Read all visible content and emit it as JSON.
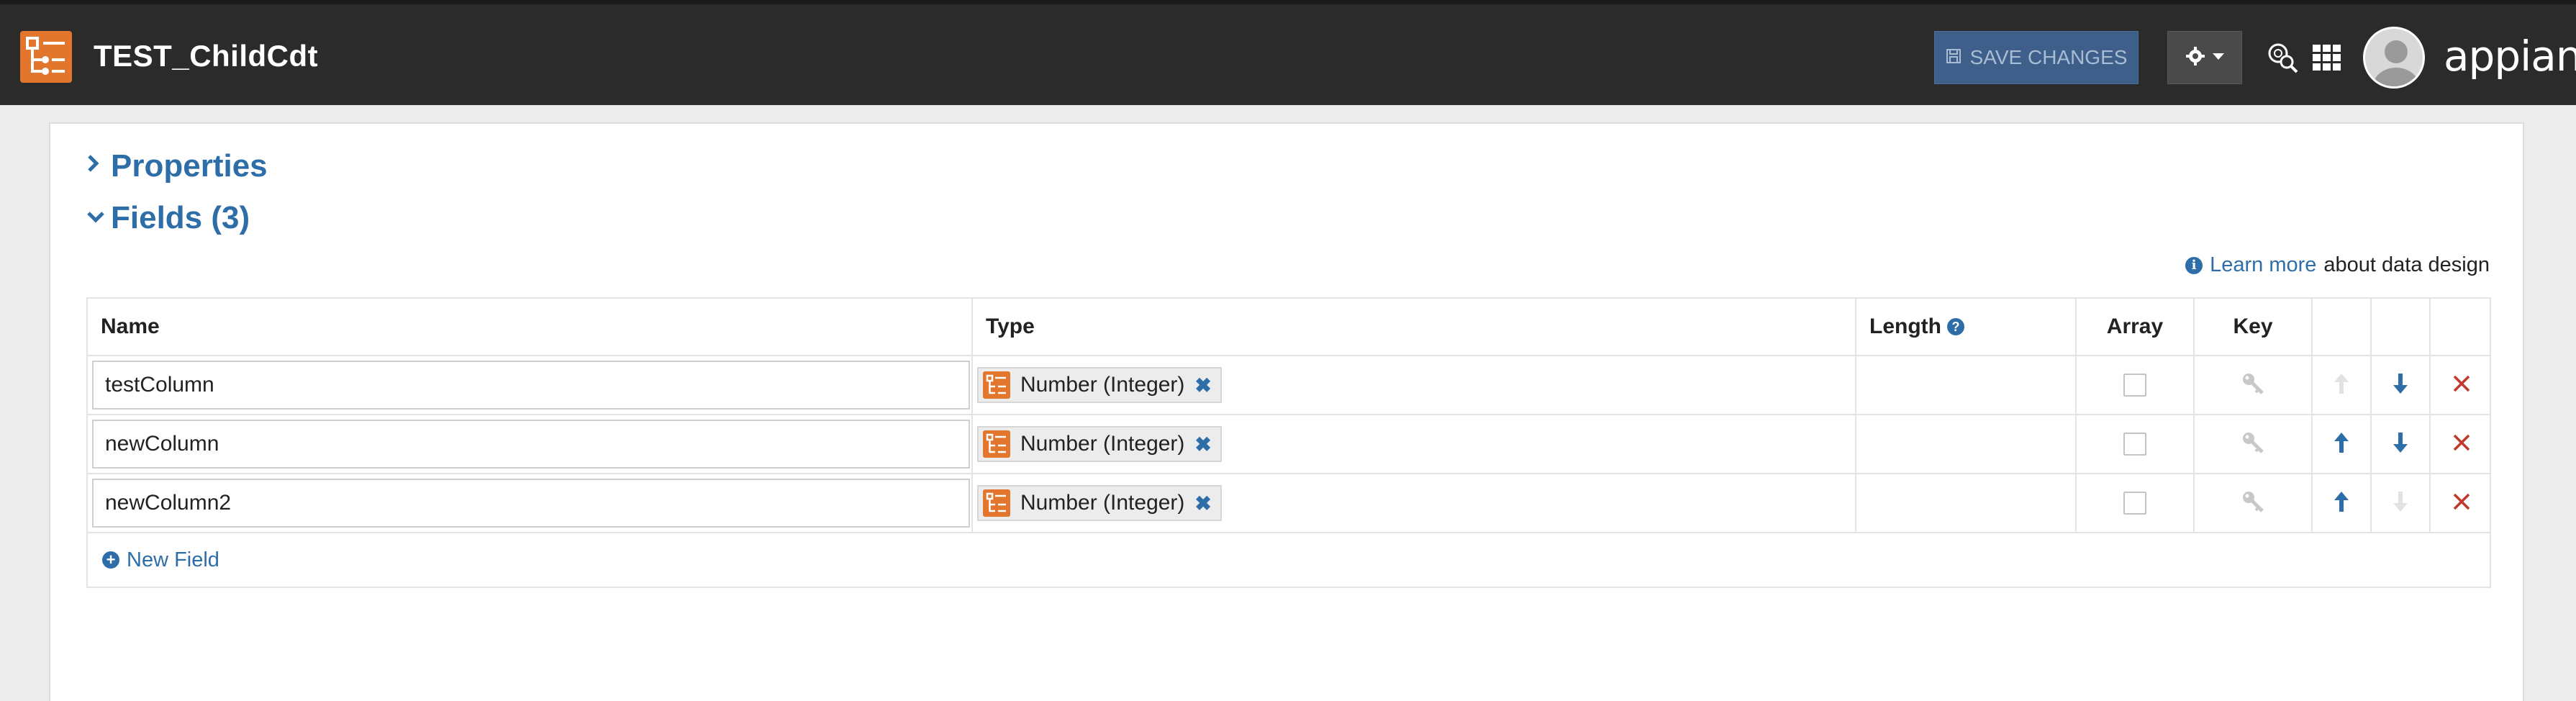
{
  "header": {
    "app_title": "TEST_ChildCdt",
    "save_label": "SAVE CHANGES",
    "brand": "appian",
    "colors": {
      "bar": "#2b2b2b",
      "logo": "#e2762c",
      "save_button": "#3d5f8a"
    }
  },
  "sections": {
    "properties_label": "Properties",
    "fields_label": "Fields (3)"
  },
  "help": {
    "learn_more_link": "Learn more",
    "learn_more_suffix": "about data design"
  },
  "table": {
    "headers": {
      "name": "Name",
      "type": "Type",
      "length": "Length",
      "array": "Array",
      "key": "Key"
    },
    "rows": [
      {
        "name": "testColumn",
        "type": "Number (Integer)",
        "array": false,
        "can_move_up": false,
        "can_move_down": true
      },
      {
        "name": "newColumn",
        "type": "Number (Integer)",
        "array": false,
        "can_move_up": true,
        "can_move_down": true
      },
      {
        "name": "newColumn2",
        "type": "Number (Integer)",
        "array": false,
        "can_move_up": true,
        "can_move_down": false
      }
    ],
    "new_field_label": "New Field"
  },
  "icons": {
    "logo": "record-type-icon",
    "gear": "gear-icon",
    "search": "global-search-icon",
    "apps": "app-grid-icon",
    "key": "key-icon",
    "up": "arrow-up-icon",
    "down": "arrow-down-icon",
    "delete": "delete-x-icon"
  },
  "accent_color": "#2e6ea8",
  "delete_color": "#c0392b"
}
